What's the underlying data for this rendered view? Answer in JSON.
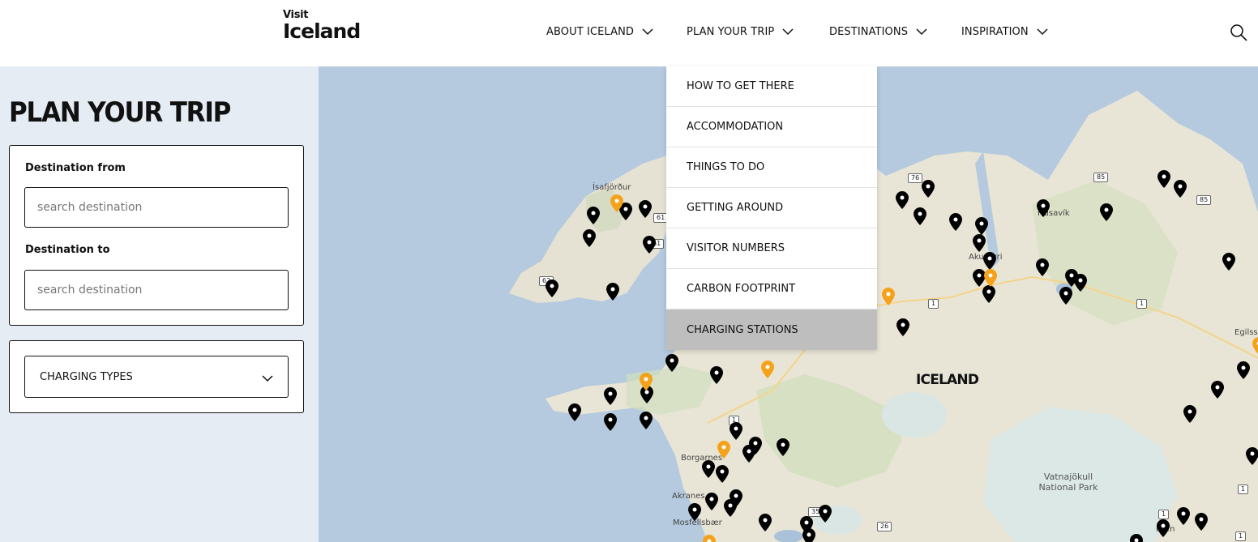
{
  "header": {
    "logo_line1": "Visit",
    "logo_line2": "Iceland",
    "nav": [
      {
        "label": "ABOUT ICELAND"
      },
      {
        "label": "PLAN YOUR TRIP"
      },
      {
        "label": "DESTINATIONS"
      },
      {
        "label": "INSPIRATION"
      }
    ]
  },
  "dropdown": {
    "items": [
      {
        "label": "HOW TO GET THERE"
      },
      {
        "label": "ACCOMMODATION"
      },
      {
        "label": "THINGS TO DO"
      },
      {
        "label": "GETTING AROUND"
      },
      {
        "label": "VISITOR NUMBERS"
      },
      {
        "label": "CARBON FOOTPRINT"
      },
      {
        "label": "CHARGING STATIONS",
        "highlighted": true
      }
    ]
  },
  "sidebar": {
    "title": "PLAN YOUR TRIP",
    "from_label": "Destination from",
    "from_placeholder": "search destination",
    "to_label": "Destination to",
    "to_placeholder": "search destination",
    "charging_types_label": "CHARGING TYPES"
  },
  "map": {
    "country_label": "ICELAND",
    "park_label_1": "Vatnajökull",
    "park_label_2": "National Park",
    "places": [
      "Ísafjörður",
      "Húsavík",
      "Akureyri",
      "Borgarnes",
      "Akranes",
      "Mosfellsbær",
      "Höfn",
      "Egilsstaðir"
    ],
    "roads": [
      "76",
      "85",
      "85",
      "61",
      "61",
      "62",
      "1",
      "1",
      "1",
      "1",
      "1",
      "1",
      "35",
      "26"
    ],
    "pin_colors": {
      "standard": "#000000",
      "fast": "#f5a21b"
    }
  }
}
